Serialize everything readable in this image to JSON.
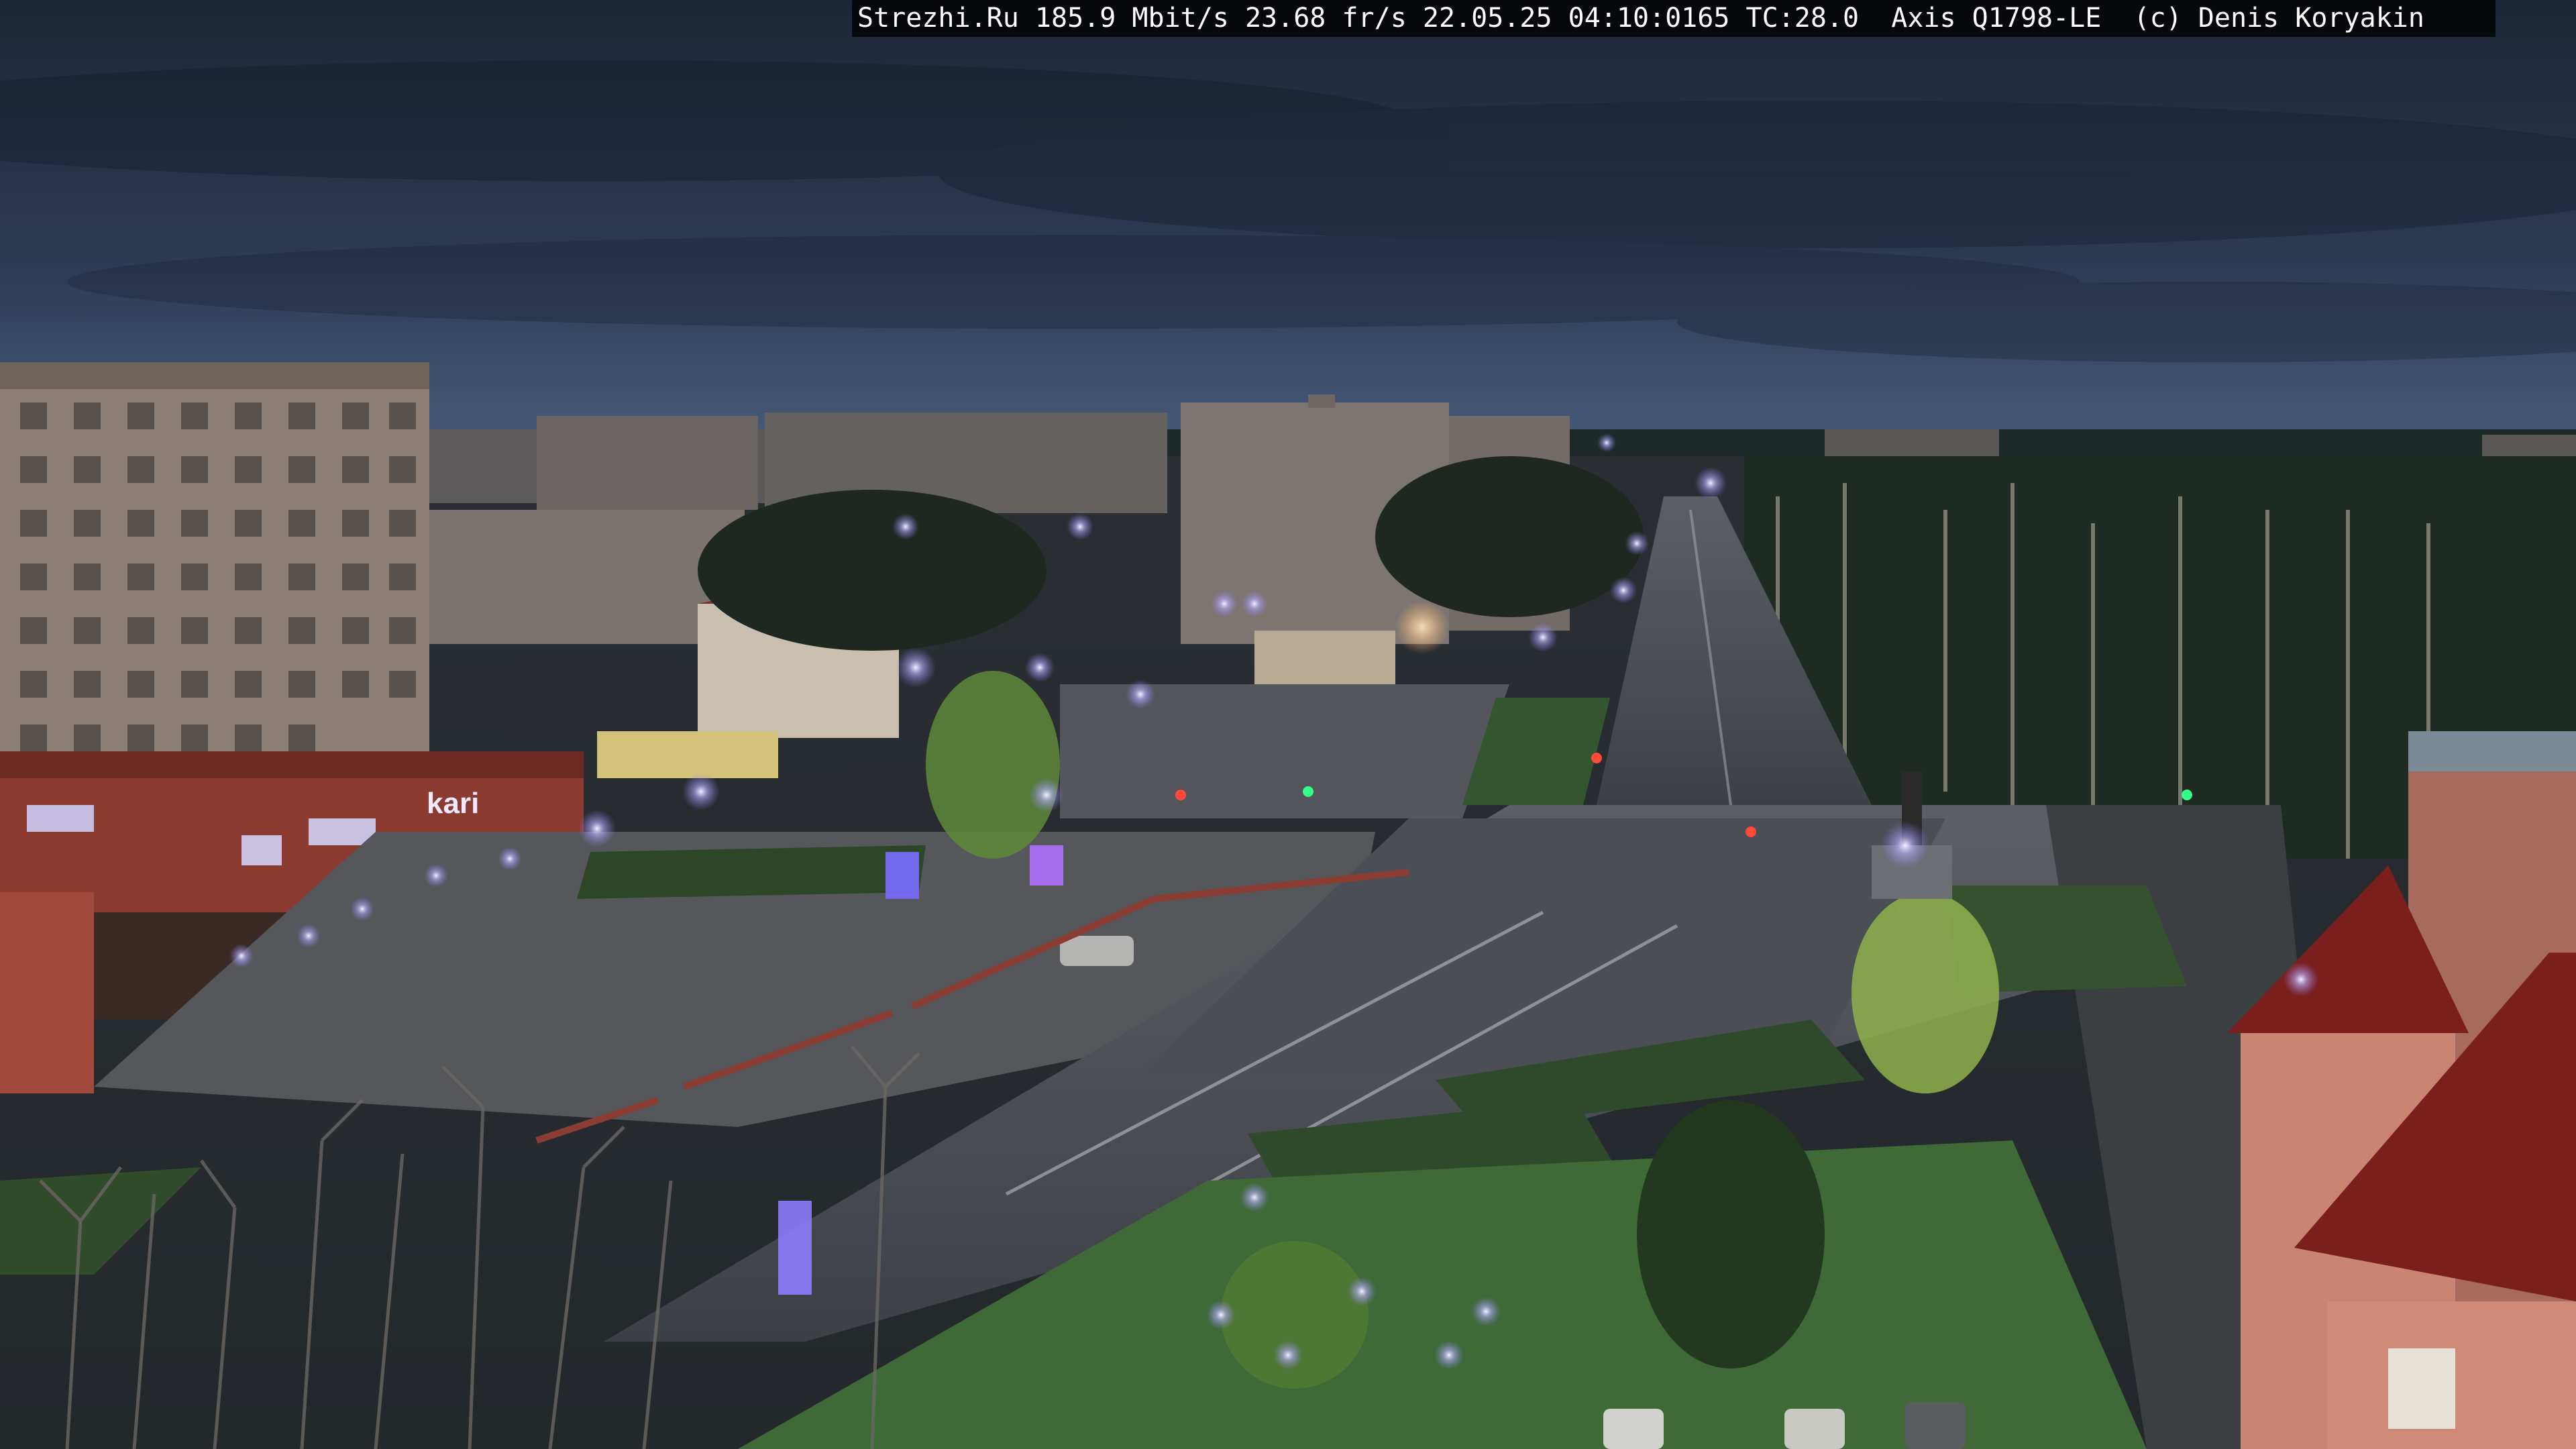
{
  "camera_overlay": {
    "text": "Strezhi.Ru 185.9 Mbit/s 23.68 fr/s 22.05.25 04:10:0165 TC:28.0  Axis Q1798-LE  (c) Denis Koryakin"
  },
  "scene": {
    "description_type": "night street webcam view",
    "storefront_sign": "kari",
    "colors": {
      "sky_top": "#1f2a3d",
      "sky_horizon": "#3a4e6b",
      "road": "#4a4d55",
      "grass": "#3f6a37",
      "street_light": "#d9d2ff",
      "building_red": "#8a3a2e",
      "building_panel": "#8c8074"
    }
  }
}
